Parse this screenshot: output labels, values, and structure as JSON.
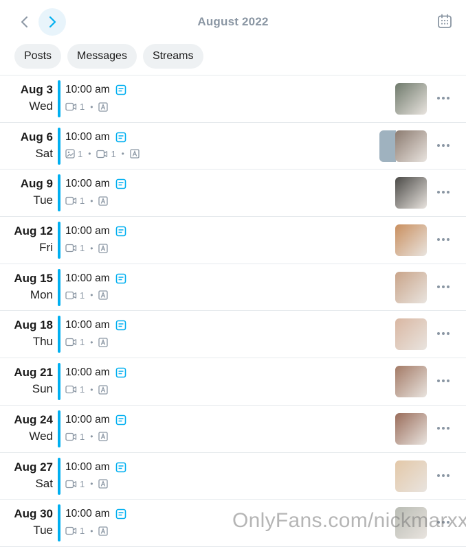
{
  "header": {
    "title": "August 2022",
    "prev_icon": "chevron-left-icon",
    "next_icon": "chevron-right-icon",
    "calendar_icon": "calendar-icon"
  },
  "tabs": [
    {
      "label": "Posts"
    },
    {
      "label": "Messages"
    },
    {
      "label": "Streams"
    }
  ],
  "colors": {
    "accent": "#00aff0",
    "muted": "#8a96a3",
    "tab_bg": "#eef1f3"
  },
  "rows": [
    {
      "day": "Aug 3",
      "weekday": "Wed",
      "time": "10:00 am",
      "photos": null,
      "videos": "1",
      "thumb_color": "#6f7a6c"
    },
    {
      "day": "Aug 6",
      "weekday": "Sat",
      "time": "10:00 am",
      "photos": "1",
      "videos": "1",
      "thumb_color": "#8c7b70",
      "back_thumb_color": "#9fb2bf"
    },
    {
      "day": "Aug 9",
      "weekday": "Tue",
      "time": "10:00 am",
      "photos": null,
      "videos": "1",
      "thumb_color": "#4b4a47"
    },
    {
      "day": "Aug 12",
      "weekday": "Fri",
      "time": "10:00 am",
      "photos": null,
      "videos": "1",
      "thumb_color": "#c98f5f"
    },
    {
      "day": "Aug 15",
      "weekday": "Mon",
      "time": "10:00 am",
      "photos": null,
      "videos": "1",
      "thumb_color": "#c9a489"
    },
    {
      "day": "Aug 18",
      "weekday": "Thu",
      "time": "10:00 am",
      "photos": null,
      "videos": "1",
      "thumb_color": "#d9b7a2"
    },
    {
      "day": "Aug 21",
      "weekday": "Sun",
      "time": "10:00 am",
      "photos": null,
      "videos": "1",
      "thumb_color": "#a37a66"
    },
    {
      "day": "Aug 24",
      "weekday": "Wed",
      "time": "10:00 am",
      "photos": null,
      "videos": "1",
      "thumb_color": "#9a6d5b"
    },
    {
      "day": "Aug 27",
      "weekday": "Sat",
      "time": "10:00 am",
      "photos": null,
      "videos": "1",
      "thumb_color": "#e3c8a8"
    },
    {
      "day": "Aug 30",
      "weekday": "Tue",
      "time": "10:00 am",
      "photos": null,
      "videos": "1",
      "thumb_color": "#b9bcb4"
    }
  ],
  "watermark": "OnlyFans.com/nickmarxx"
}
